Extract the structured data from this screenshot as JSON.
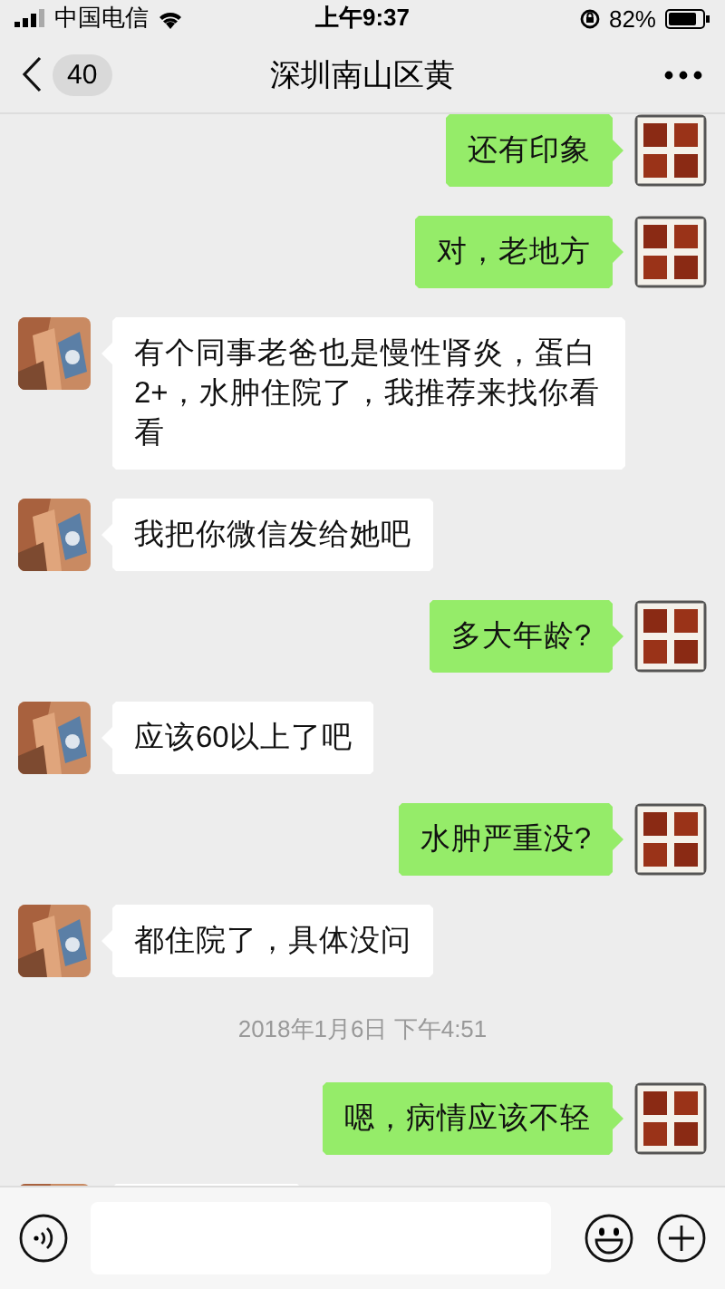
{
  "status_bar": {
    "carrier": "中国电信",
    "time": "上午9:37",
    "battery": "82%"
  },
  "header": {
    "unread_count": "40",
    "title": "深圳南山区黄"
  },
  "messages": [
    {
      "kind": "sent",
      "text": "还有印象"
    },
    {
      "kind": "sent",
      "text": "对，老地方"
    },
    {
      "kind": "received",
      "text": "有个同事老爸也是慢性肾炎，蛋白2+，水肿住院了，我推荐来找你看看"
    },
    {
      "kind": "received",
      "text": "我把你微信发给她吧"
    },
    {
      "kind": "sent",
      "text": "多大年龄?"
    },
    {
      "kind": "received",
      "text": "应该60以上了吧"
    },
    {
      "kind": "sent",
      "text": "水肿严重没?"
    },
    {
      "kind": "received",
      "text": "都住院了，具体没问"
    },
    {
      "kind": "timestamp",
      "text": "2018年1月6日 下午4:51"
    },
    {
      "kind": "sent",
      "text": "嗯，病情应该不轻"
    },
    {
      "kind": "received"
    }
  ]
}
